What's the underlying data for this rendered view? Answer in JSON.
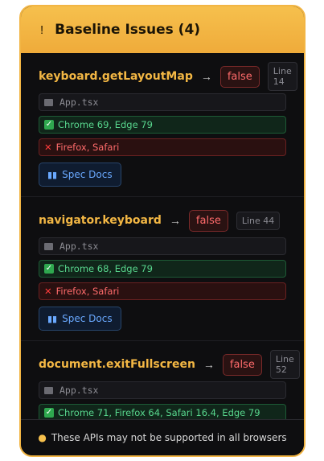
{
  "header": {
    "title": "Baseline Issues (4)",
    "icon": "warning-icon"
  },
  "items": [
    {
      "api": "keyboard.getLayoutMap",
      "value": "false",
      "line": "Line 14",
      "file": "App.tsx",
      "supported": "Chrome 69, Edge 79",
      "unsupported": "Firefox, Safari",
      "spec_label": "Spec Docs"
    },
    {
      "api": "navigator.keyboard",
      "value": "false",
      "line": "Line 44",
      "file": "App.tsx",
      "supported": "Chrome 68, Edge 79",
      "unsupported": "Firefox, Safari",
      "spec_label": "Spec Docs"
    },
    {
      "api": "document.exitFullscreen",
      "value": "false",
      "line": "Line 52",
      "file": "App.tsx",
      "supported": "Chrome 71, Firefox 64, Safari 16.4, Edge 79"
    }
  ],
  "arrow": "→",
  "footer": {
    "text": "These APIs may not be supported in all browsers"
  },
  "colors": {
    "accent": "#f3b744",
    "false": "#ff6b6b",
    "ok": "#58d68d",
    "link": "#6aa9ff"
  }
}
